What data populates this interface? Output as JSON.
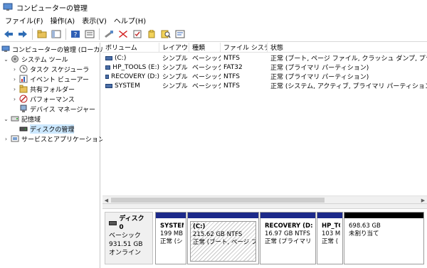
{
  "window": {
    "title": "コンピューターの管理"
  },
  "menu": [
    "ファイル(F)",
    "操作(A)",
    "表示(V)",
    "ヘルプ(H)"
  ],
  "toolbar": {
    "icons": [
      "back-arrow-icon",
      "forward-arrow-icon",
      "up-folder-icon",
      "console-tree-icon",
      "help-icon",
      "properties-icon",
      "connect-icon",
      "delete-icon",
      "check-icon",
      "folder-icon",
      "search-icon",
      "list-icon"
    ]
  },
  "tree": {
    "root": "コンピューターの管理 (ローカル)",
    "system_tools": "システム ツール",
    "task_scheduler": "タスク スケジューラ",
    "event_viewer": "イベント ビューアー",
    "shared_folders": "共有フォルダー",
    "performance": "パフォーマンス",
    "device_manager": "デバイス マネージャー",
    "storage": "記憶域",
    "disk_management": "ディスクの管理",
    "services_apps": "サービスとアプリケーション"
  },
  "volumes": {
    "headers": [
      "ボリューム",
      "レイアウト",
      "種類",
      "ファイル システム",
      "状態"
    ],
    "rows": [
      {
        "volume": "(C:)",
        "layout": "シンプル",
        "type": "ベーシック",
        "fs": "NTFS",
        "status": "正常 (ブート, ページ ファイル, クラッシュ ダンプ, プライマリ パーティ"
      },
      {
        "volume": "HP_TOOLS (E:)",
        "layout": "シンプル",
        "type": "ベーシック",
        "fs": "FAT32",
        "status": "正常 (プライマリ パーティション)"
      },
      {
        "volume": "RECOVERY (D:)",
        "layout": "シンプル",
        "type": "ベーシック",
        "fs": "NTFS",
        "status": "正常 (プライマリ パーティション)"
      },
      {
        "volume": "SYSTEM",
        "layout": "シンプル",
        "type": "ベーシック",
        "fs": "NTFS",
        "status": "正常 (システム, アクティブ, プライマリ パーティション)"
      }
    ]
  },
  "disk": {
    "name": "ディスク 0",
    "type": "ベーシック",
    "size": "931.51 GB",
    "status": "オンライン",
    "partitions": [
      {
        "name": "SYSTEM",
        "size": "199 MB",
        "status": "正常 (シ"
      },
      {
        "name": "(C:)",
        "size": "215.62 GB NTFS",
        "status": "正常 (ブート, ページ ファイ"
      },
      {
        "name": "RECOVERY  (D:)",
        "size": "16.97 GB NTFS",
        "status": "正常 (プライマリ パ"
      },
      {
        "name": "HP_TC",
        "size": "103 MI",
        "status": "正常 ("
      },
      {
        "name": "",
        "size": "698.63 GB",
        "status": "未割り当て"
      }
    ]
  }
}
